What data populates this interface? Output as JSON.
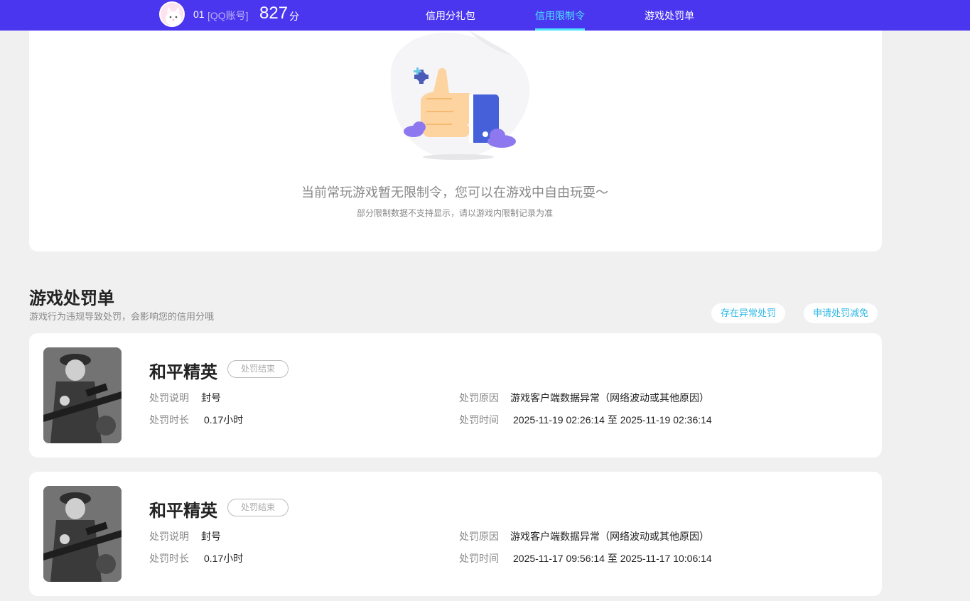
{
  "header": {
    "user_id": "01",
    "account_type": "[QQ账号]",
    "score": "827",
    "score_unit": "分",
    "tabs": [
      {
        "label": "信用分礼包",
        "active": false
      },
      {
        "label": "信用限制令",
        "active": true
      },
      {
        "label": "游戏处罚单",
        "active": false
      }
    ],
    "accent_color": "#4b36f0",
    "active_tab_color": "#4de4ff"
  },
  "empty_state": {
    "title": "当前常玩游戏暂无限制令，您可以在游戏中自由玩耍～",
    "subtitle": "部分限制数据不支持显示，请以游戏内限制记录为准"
  },
  "penalty_section": {
    "title": "游戏处罚单",
    "subtitle": "游戏行为违规导致处罚，会影响您的信用分哦",
    "buttons": {
      "abnormal": "存在异常处罚",
      "appeal": "申请处罚减免"
    },
    "field_labels": {
      "description": "处罚说明",
      "reason": "处罚原因",
      "duration": "处罚时长",
      "time": "处罚时间"
    },
    "records": [
      {
        "game": "和平精英",
        "status": "处罚结束",
        "description": "封号",
        "reason": "游戏客户端数据异常（网络波动或其他原因）",
        "duration": "0.17小时",
        "time": "2025-11-19 02:26:14 至 2025-11-19 02:36:14"
      },
      {
        "game": "和平精英",
        "status": "处罚结束",
        "description": "封号",
        "reason": "游戏客户端数据异常（网络波动或其他原因）",
        "duration": "0.17小时",
        "time": "2025-11-17 09:56:14 至 2025-11-17 10:06:14"
      }
    ]
  }
}
